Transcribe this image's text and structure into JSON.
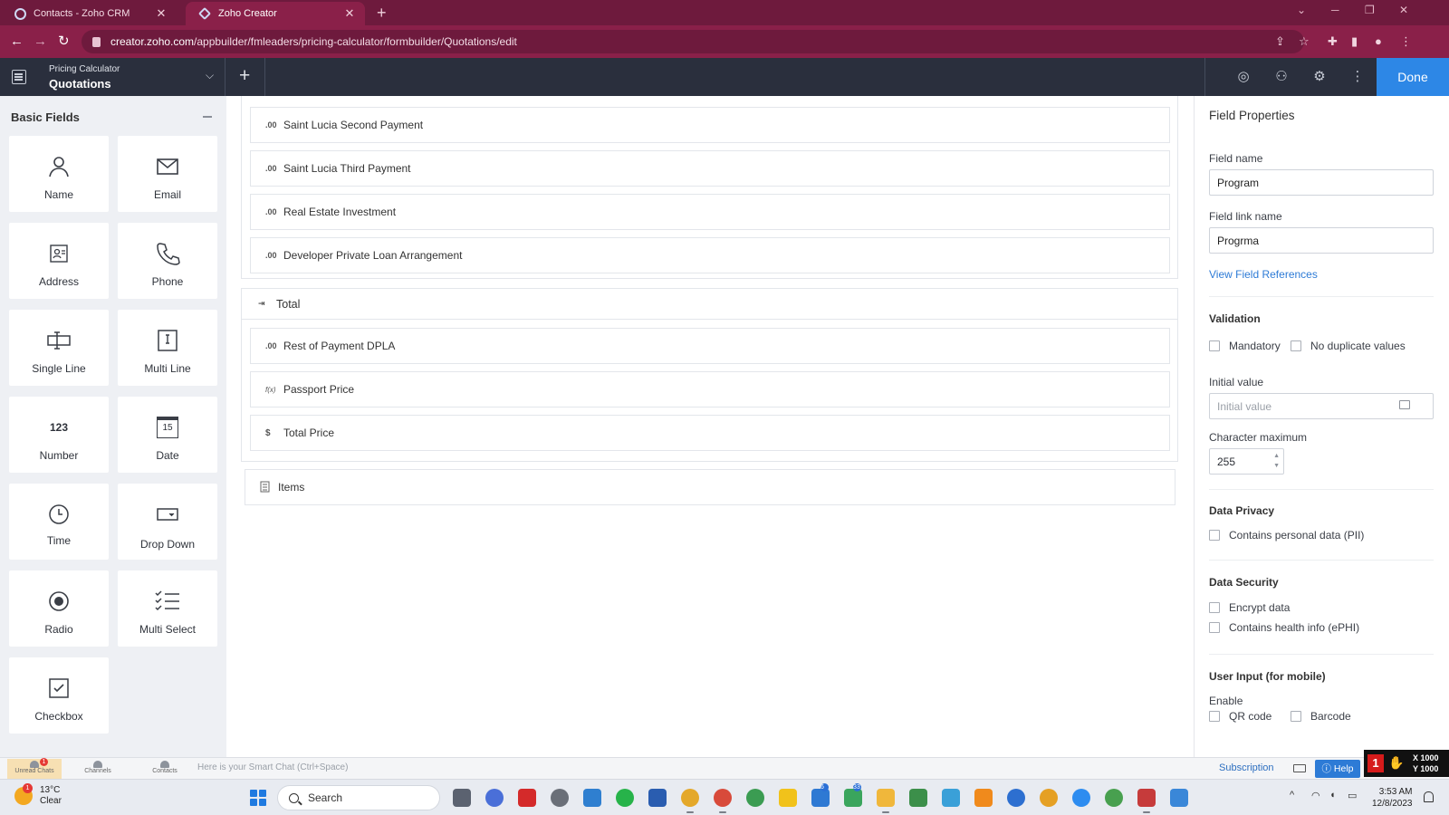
{
  "browser": {
    "tabs": [
      {
        "title": "Contacts - Zoho CRM"
      },
      {
        "title": "Zoho Creator"
      }
    ],
    "url_host": "creator.zoho.com",
    "url_path": "/appbuilder/fmleaders/pricing-calculator/formbuilder/Quotations/edit"
  },
  "app": {
    "app_name": "Pricing Calculator",
    "form_name": "Quotations",
    "done_label": "Done"
  },
  "palette": {
    "title": "Basic Fields",
    "tiles": [
      {
        "label": "Name",
        "icon": "person-icon"
      },
      {
        "label": "Email",
        "icon": "envelope-icon"
      },
      {
        "label": "Address",
        "icon": "address-card-icon"
      },
      {
        "label": "Phone",
        "icon": "phone-icon"
      },
      {
        "label": "Single Line",
        "icon": "single-line-icon"
      },
      {
        "label": "Multi Line",
        "icon": "multi-line-icon"
      },
      {
        "label": "Number",
        "icon_text": "123",
        "icon": "number-icon"
      },
      {
        "label": "Date",
        "icon_text": "15",
        "icon": "calendar-icon"
      },
      {
        "label": "Time",
        "icon": "clock-icon"
      },
      {
        "label": "Drop Down",
        "icon": "dropdown-icon"
      },
      {
        "label": "Radio",
        "icon": "radio-icon"
      },
      {
        "label": "Multi Select",
        "icon": "checklist-icon"
      },
      {
        "label": "Checkbox",
        "icon": "checkbox-icon"
      }
    ]
  },
  "canvas": {
    "fields_top": [
      {
        "icon_text": ".00",
        "label": "Saint Lucia Second Payment"
      },
      {
        "icon_text": ".00",
        "label": "Saint Lucia Third Payment"
      },
      {
        "icon_text": ".00",
        "label": "Real Estate Investment"
      },
      {
        "icon_text": ".00",
        "label": "Developer Private Loan Arrangement"
      }
    ],
    "section_total": {
      "label": "Total",
      "icon": "section-icon"
    },
    "fields_total": [
      {
        "icon_text": ".00",
        "label": "Rest of Payment DPLA"
      },
      {
        "icon_text": "f(x)",
        "label": "Passport Price"
      },
      {
        "icon_text": "$",
        "label": "Total Price"
      }
    ],
    "items_row": {
      "label": "Items",
      "icon": "subform-icon"
    }
  },
  "properties": {
    "title": "Field Properties",
    "field_name_label": "Field name",
    "field_name_value": "Program",
    "field_link_label": "Field link name",
    "field_link_value": "Progrma",
    "view_refs": "View Field References",
    "validation_title": "Validation",
    "mandatory": "Mandatory",
    "no_duplicates": "No duplicate values",
    "initial_value_label": "Initial value",
    "initial_value_placeholder": "Initial value",
    "char_max_label": "Character maximum",
    "char_max_value": "255",
    "privacy_title": "Data Privacy",
    "contains_pii": "Contains personal data (PII)",
    "security_title": "Data Security",
    "encrypt": "Encrypt data",
    "health": "Contains health info (ePHI)",
    "user_input_title": "User Input (for mobile)",
    "enable_label": "Enable",
    "qr": "QR code",
    "barcode": "Barcode"
  },
  "bottombar": {
    "items": [
      {
        "label": "Unread Chats",
        "badge": "1"
      },
      {
        "label": "Channels"
      },
      {
        "label": "Contacts"
      }
    ],
    "smart_chat": "Here is your Smart Chat (Ctrl+Space)",
    "subscription": "Subscription",
    "help": "Help",
    "coord_x": "X 1000",
    "coord_y": "Y 1000",
    "coord_badge": "1"
  },
  "taskbar": {
    "temp": "13°C",
    "condition": "Clear",
    "weather_badge": "1",
    "search_label": "Search",
    "badge_a": "6",
    "badge_b": "33",
    "time": "3:53 AM",
    "date": "12/8/2023"
  }
}
